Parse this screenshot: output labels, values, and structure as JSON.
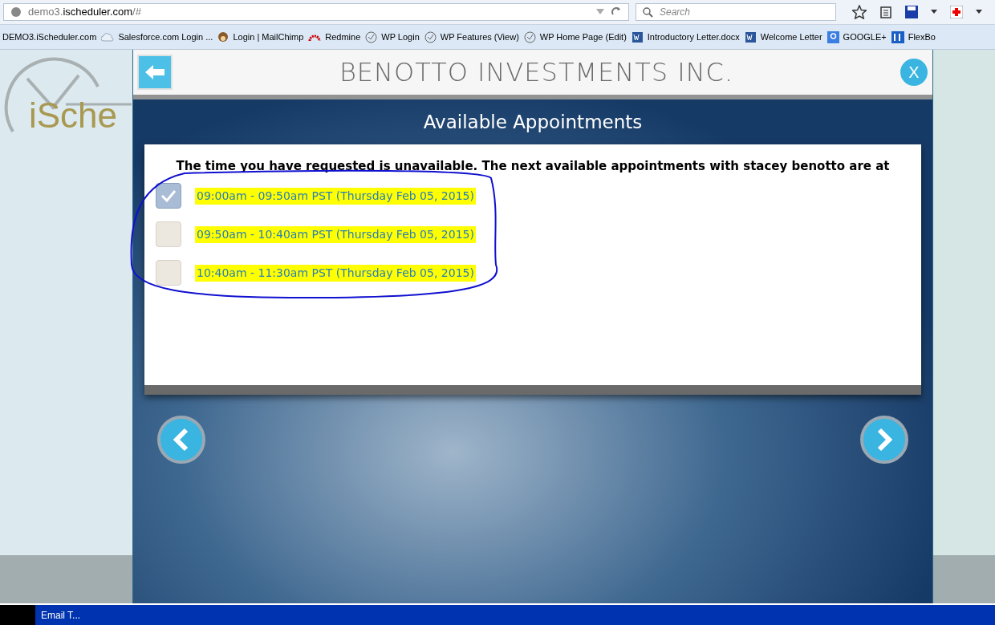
{
  "browser": {
    "url_host": "demo3.",
    "url_domain": "ischeduler.com",
    "url_path": "/#",
    "search": {
      "placeholder": "Search"
    },
    "bookmarks": [
      {
        "label": "DEMO3.iScheduler.com",
        "kind": "none"
      },
      {
        "label": "Salesforce.com Login ...",
        "kind": "cloud"
      },
      {
        "label": "Login | MailChimp",
        "kind": "chimp"
      },
      {
        "label": "Redmine",
        "kind": "redmine"
      },
      {
        "label": "WP Login",
        "kind": "clock"
      },
      {
        "label": "WP Features (View)",
        "kind": "clock"
      },
      {
        "label": "WP Home Page (Edit)",
        "kind": "clock"
      },
      {
        "label": "Introductory Letter.docx",
        "kind": "word"
      },
      {
        "label": "Welcome Letter",
        "kind": "word"
      },
      {
        "label": "GOOGLE+",
        "kind": "google"
      },
      {
        "label": "FlexBo",
        "kind": "fb"
      }
    ]
  },
  "background": {
    "logo_text": "iSche"
  },
  "modal": {
    "company": "BENOTTO INVESTMENTS INC.",
    "close": "X",
    "heading": "Available Appointments",
    "message": "The time you have requested is unavailable. The next available appointments with stacey benotto are at",
    "appointments": [
      {
        "label": "09:00am - 09:50am PST (Thursday Feb 05, 2015)",
        "selected": true,
        "highlighted": true
      },
      {
        "label": "09:50am - 10:40am PST (Thursday Feb 05, 2015)",
        "selected": false,
        "highlighted": true
      },
      {
        "label": "10:40am - 11:30am PST (Thursday Feb 05, 2015)",
        "selected": false,
        "highlighted": true
      }
    ]
  },
  "taskbar": {
    "items": [
      "Email T..."
    ]
  }
}
